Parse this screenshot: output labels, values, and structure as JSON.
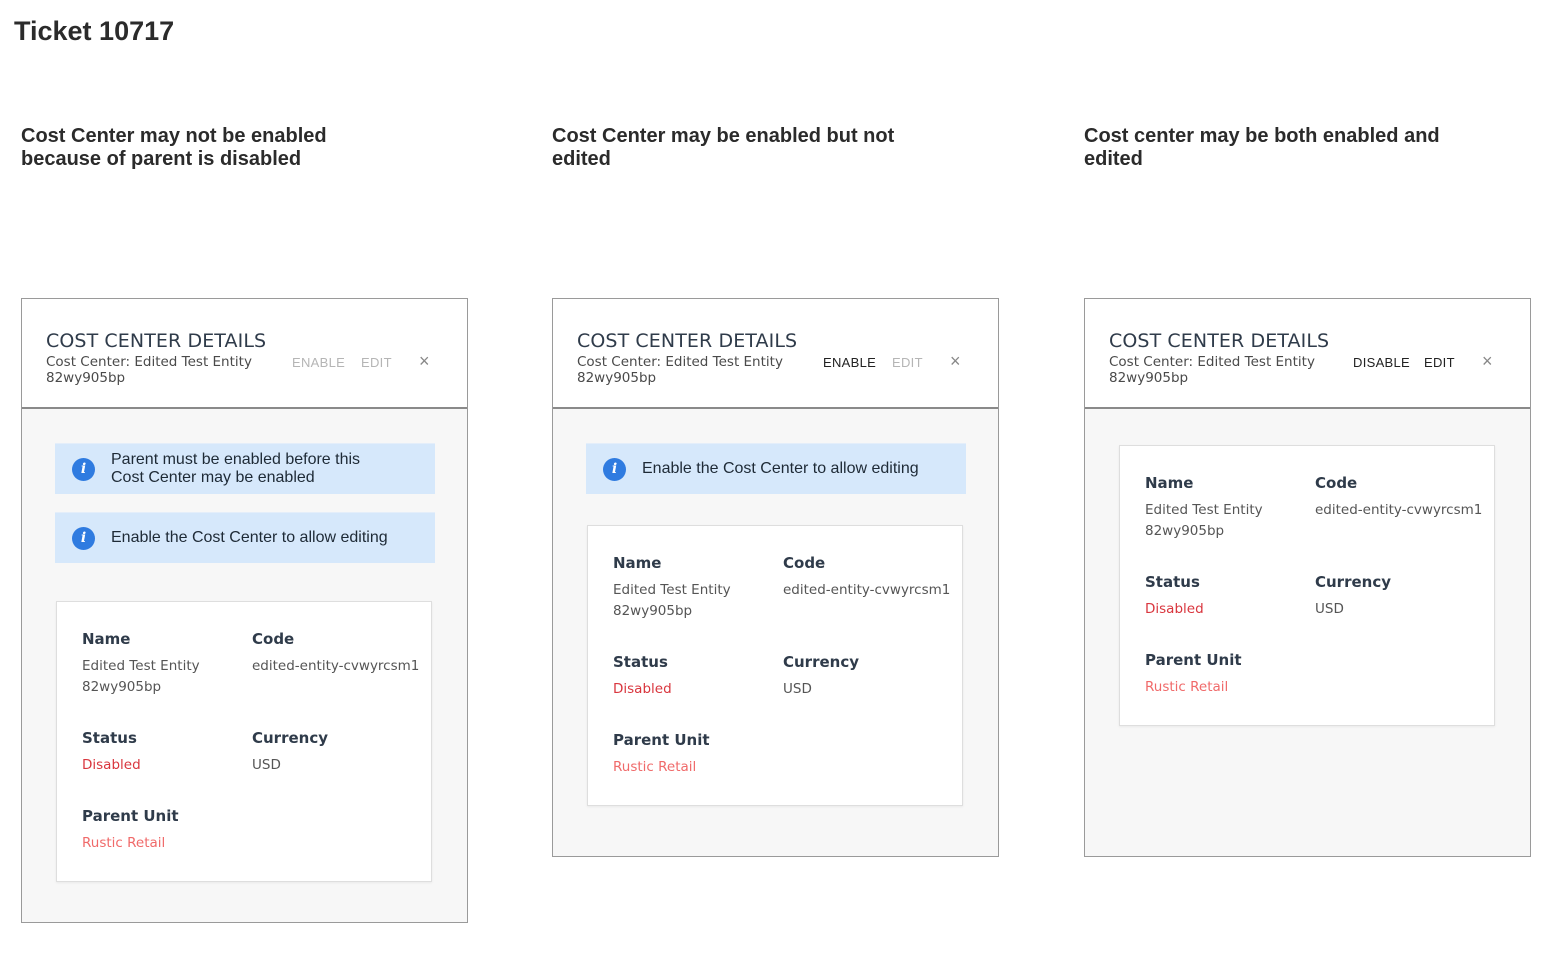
{
  "page_title": "Ticket 10717",
  "columns": [
    {
      "heading": "Cost Center may not be enabled because of parent is disabled",
      "panel": {
        "title": "COST CENTER DETAILS",
        "subtitle": "Cost Center: Edited Test Entity 82wy905bp",
        "actions": [
          {
            "label": "ENABLE",
            "state": "disabled"
          },
          {
            "label": "EDIT",
            "state": "disabled"
          }
        ],
        "close": "×",
        "alerts": [
          "Parent must be enabled before this Cost Center may be enabled",
          "Enable the Cost Center to allow editing"
        ],
        "fields": {
          "name_label": "Name",
          "name_value": "Edited Test Entity 82wy905bp",
          "code_label": "Code",
          "code_value": "edited-entity-cvwyrcsm1",
          "status_label": "Status",
          "status_value": "Disabled",
          "currency_label": "Currency",
          "currency_value": "USD",
          "parent_label": "Parent Unit",
          "parent_value": "Rustic Retail"
        }
      }
    },
    {
      "heading": "Cost Center may be enabled but not edited",
      "panel": {
        "title": "COST CENTER DETAILS",
        "subtitle": "Cost Center: Edited Test Entity 82wy905bp",
        "actions": [
          {
            "label": "ENABLE",
            "state": "enabled"
          },
          {
            "label": "EDIT",
            "state": "disabled"
          }
        ],
        "close": "×",
        "alerts": [
          "Enable the Cost Center to allow editing"
        ],
        "fields": {
          "name_label": "Name",
          "name_value": "Edited Test Entity 82wy905bp",
          "code_label": "Code",
          "code_value": "edited-entity-cvwyrcsm1",
          "status_label": "Status",
          "status_value": "Disabled",
          "currency_label": "Currency",
          "currency_value": "USD",
          "parent_label": "Parent Unit",
          "parent_value": "Rustic Retail"
        }
      }
    },
    {
      "heading": "Cost center may be both enabled and edited",
      "panel": {
        "title": "COST CENTER DETAILS",
        "subtitle": "Cost Center: Edited Test Entity 82wy905bp",
        "actions": [
          {
            "label": "DISABLE",
            "state": "enabled"
          },
          {
            "label": "EDIT",
            "state": "enabled"
          }
        ],
        "close": "×",
        "alerts": [],
        "fields": {
          "name_label": "Name",
          "name_value": "Edited Test Entity 82wy905bp",
          "code_label": "Code",
          "code_value": "edited-entity-cvwyrcsm1",
          "status_label": "Status",
          "status_value": "Disabled",
          "currency_label": "Currency",
          "currency_value": "USD",
          "parent_label": "Parent Unit",
          "parent_value": "Rustic Retail"
        }
      }
    }
  ],
  "colors": {
    "alert_bg": "#d6e8fb",
    "info_icon": "#2f7be0",
    "status_disabled": "#d9363e",
    "parent_link": "#f06a6a",
    "action_disabled": "#b5b5b5"
  }
}
